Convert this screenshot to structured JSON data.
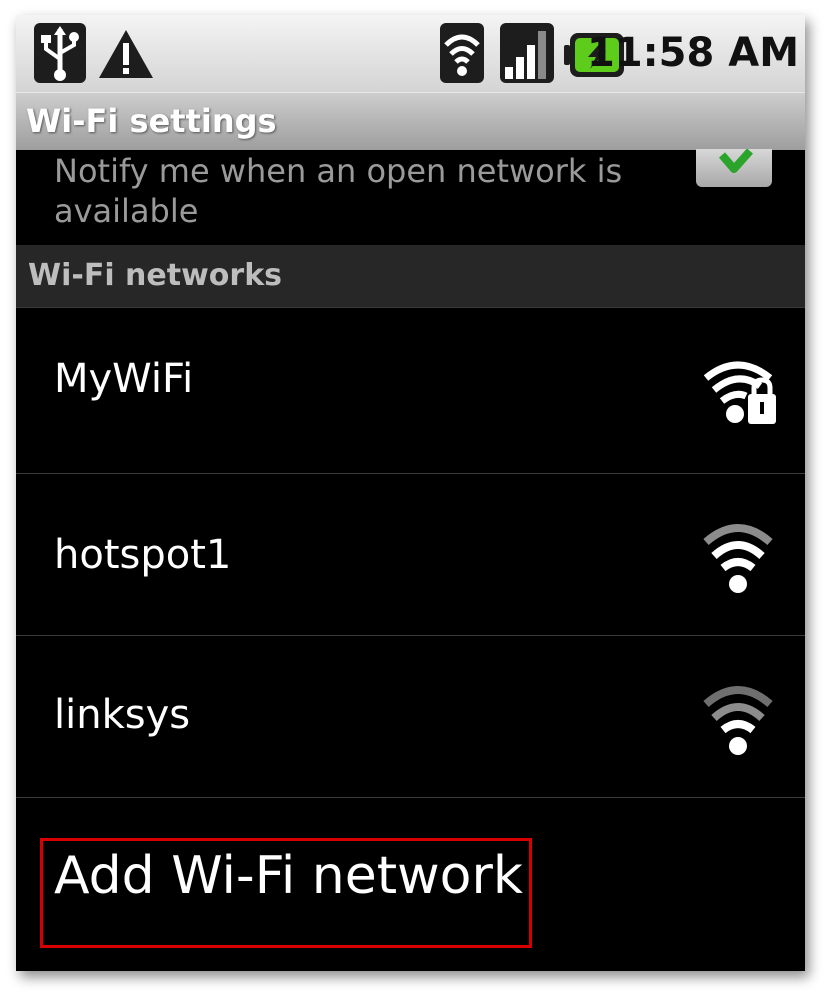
{
  "status_bar": {
    "time": "11:58 AM",
    "battery_color": "#5ecc1a"
  },
  "title_bar": {
    "title": "Wi-Fi settings"
  },
  "notify": {
    "text": "Notify me when an open network is available",
    "checked": true,
    "check_color": "#2aa42a"
  },
  "section": {
    "header": "Wi-Fi networks"
  },
  "networks": [
    {
      "name": "MyWiFi",
      "icon": "wifi-lock-icon",
      "secured": true
    },
    {
      "name": "hotspot1",
      "icon": "wifi-icon",
      "secured": false
    },
    {
      "name": "linksys",
      "icon": "wifi-icon",
      "secured": false
    }
  ],
  "add_network": {
    "label": "Add Wi-Fi network",
    "highlight_color": "#d60000"
  }
}
